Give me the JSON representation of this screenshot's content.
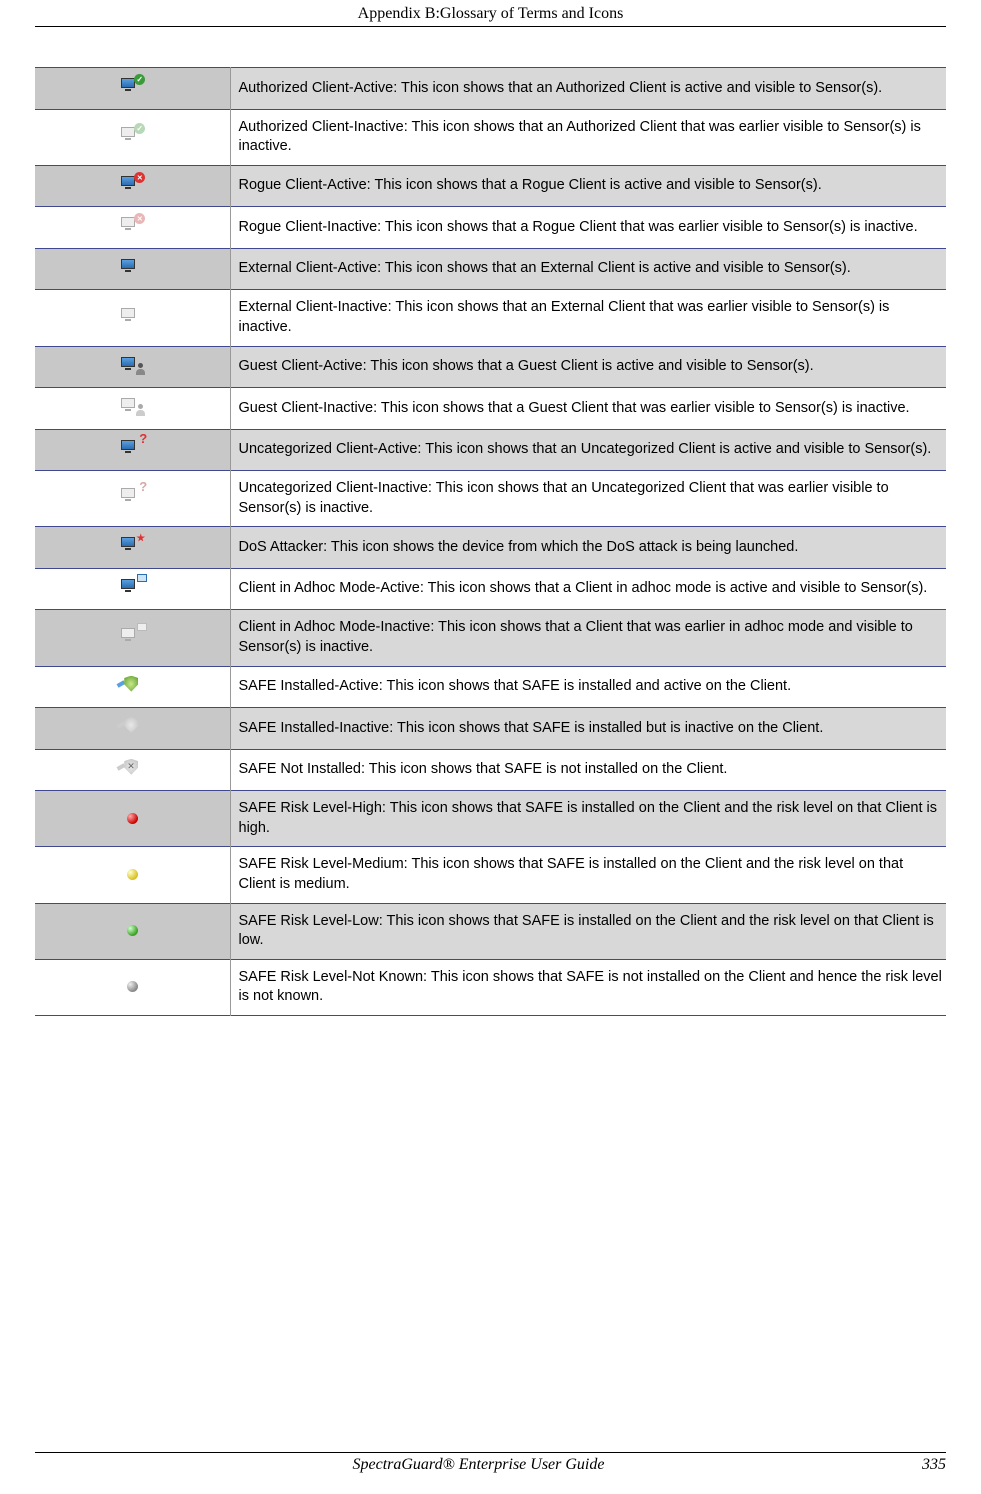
{
  "header": "Appendix B:Glossary of Terms and Icons",
  "footer": {
    "title": "SpectraGuard® Enterprise User Guide",
    "page": "335"
  },
  "rows": [
    {
      "shade": true,
      "icon": "authorized-client-active-icon",
      "desc": "Authorized Client-Active: This icon shows that an Authorized Client is active and visible to Sensor(s)."
    },
    {
      "shade": false,
      "icon": "authorized-client-inactive-icon",
      "desc": "Authorized Client-Inactive: This icon shows that an Authorized Client that was earlier visible to Sensor(s) is inactive."
    },
    {
      "shade": true,
      "icon": "rogue-client-active-icon",
      "desc": "Rogue Client-Active: This icon shows that a Rogue Client is active and visible to Sensor(s)."
    },
    {
      "shade": false,
      "icon": "rogue-client-inactive-icon",
      "desc": "Rogue Client-Inactive: This icon shows that a Rogue Client that was earlier visible to Sensor(s) is inactive."
    },
    {
      "shade": true,
      "icon": "external-client-active-icon",
      "desc": "External Client-Active: This icon shows that an External Client is active and visible to Sensor(s)."
    },
    {
      "shade": false,
      "icon": "external-client-inactive-icon",
      "desc": "External Client-Inactive: This icon shows that an External Client that was earlier visible to Sensor(s) is inactive."
    },
    {
      "shade": true,
      "icon": "guest-client-active-icon",
      "desc": "Guest Client-Active: This icon shows that a Guest Client is active and visible to Sensor(s)."
    },
    {
      "shade": false,
      "icon": "guest-client-inactive-icon",
      "desc": "Guest Client-Inactive: This icon shows that a Guest Client that was earlier visible to Sensor(s) is inactive."
    },
    {
      "shade": true,
      "icon": "uncategorized-client-active-icon",
      "desc": "Uncategorized Client-Active: This icon shows that an Uncategorized Client is active and visible to Sensor(s)."
    },
    {
      "shade": false,
      "icon": "uncategorized-client-inactive-icon",
      "desc": "Uncategorized Client-Inactive: This icon shows that an Uncategorized Client that was earlier visible to Sensor(s) is inactive."
    },
    {
      "shade": true,
      "icon": "dos-attacker-icon",
      "desc": "DoS Attacker: This icon shows the device from which the DoS attack is being launched."
    },
    {
      "shade": false,
      "icon": "adhoc-client-active-icon",
      "desc": "Client in Adhoc Mode-Active: This icon shows that a Client in adhoc mode is active and visible to Sensor(s)."
    },
    {
      "shade": true,
      "icon": "adhoc-client-inactive-icon",
      "desc": "Client in Adhoc Mode-Inactive: This icon shows that a Client that was earlier in adhoc mode and visible to Sensor(s) is inactive."
    },
    {
      "shade": false,
      "icon": "safe-installed-active-icon",
      "desc": "SAFE Installed-Active: This icon shows that SAFE is installed and active on the Client."
    },
    {
      "shade": true,
      "icon": "safe-installed-inactive-icon",
      "desc": "SAFE Installed-Inactive: This icon shows that SAFE is installed but is inactive on the Client."
    },
    {
      "shade": false,
      "icon": "safe-not-installed-icon",
      "desc": "SAFE Not Installed: This icon shows that SAFE is not installed on the Client."
    },
    {
      "shade": true,
      "icon": "safe-risk-high-icon",
      "desc": "SAFE Risk Level-High: This icon shows that SAFE is installed on the Client and the risk level on that Client is high."
    },
    {
      "shade": false,
      "icon": "safe-risk-medium-icon",
      "desc": "SAFE Risk Level-Medium: This icon shows that SAFE is installed on the Client and the risk level on that Client is medium."
    },
    {
      "shade": true,
      "icon": "safe-risk-low-icon",
      "desc": "SAFE Risk Level-Low: This icon shows that SAFE is installed on the Client and the risk level on that Client is low."
    },
    {
      "shade": false,
      "icon": "safe-risk-unknown-icon",
      "desc": "SAFE Risk Level-Not Known: This icon shows that SAFE is not installed on the Client and hence the risk level is not known."
    }
  ]
}
